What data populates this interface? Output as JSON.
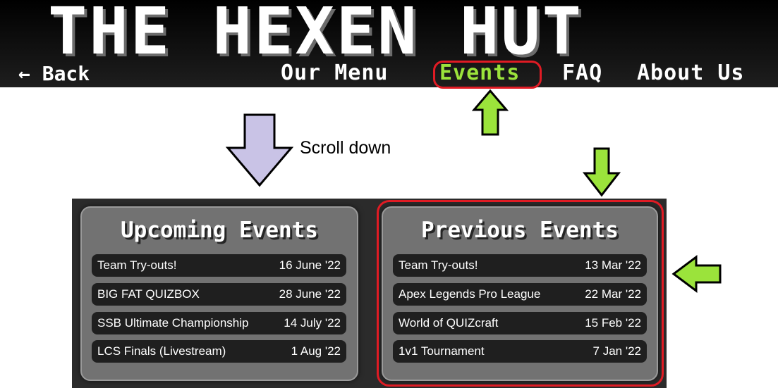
{
  "header": {
    "title": "THE HEXEN HUT",
    "back_label": "← Back",
    "nav": [
      {
        "label": "Our Menu",
        "active": false
      },
      {
        "label": "Events",
        "active": true
      },
      {
        "label": "FAQ",
        "active": false
      },
      {
        "label": "About Us",
        "active": false
      }
    ]
  },
  "annotation": {
    "scroll_label": "Scroll down"
  },
  "upcoming": {
    "title": "Upcoming Events",
    "events": [
      {
        "name": "Team Try-outs!",
        "date": "16 June '22"
      },
      {
        "name": "BIG FAT QUIZBOX",
        "date": "28 June '22"
      },
      {
        "name": "SSB Ultimate Championship",
        "date": "14 July '22"
      },
      {
        "name": "LCS Finals (Livestream)",
        "date": "1 Aug '22"
      }
    ]
  },
  "previous": {
    "title": "Previous Events",
    "events": [
      {
        "name": "Team Try-outs!",
        "date": "13 Mar '22"
      },
      {
        "name": "Apex Legends Pro League",
        "date": "22 Mar '22"
      },
      {
        "name": "World of QUIZcraft",
        "date": "15 Feb '22"
      },
      {
        "name": "1v1 Tournament",
        "date": "7 Jan '22"
      }
    ]
  },
  "colors": {
    "accent_green": "#9be33b",
    "highlight_red": "#e01b24",
    "scroll_arrow": "#c9c3e6",
    "header_bg": "#111111",
    "card_bg": "#727272",
    "row_bg": "#1f1f1f"
  },
  "icons": [
    "left-arrow-icon",
    "up-arrow-icon",
    "down-arrow-icon",
    "left-pointing-arrow-icon"
  ]
}
